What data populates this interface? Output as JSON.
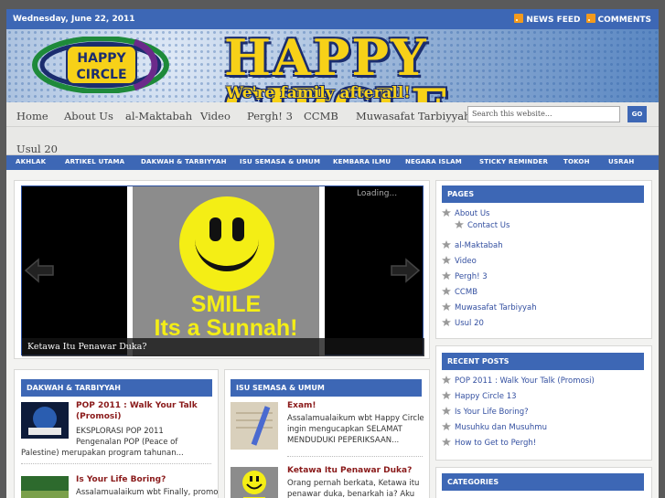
{
  "topbar": {
    "date": "Wednesday, June 22, 2011",
    "news_feed": "NEWS FEED",
    "comments": "COMMENTS"
  },
  "header": {
    "logo_line1": "HAPPY",
    "logo_line2": "CIRCLE",
    "title": "HAPPY CIRCLE",
    "tagline": "We're family afterall!"
  },
  "nav_main": [
    "Home",
    "About Us",
    "al-Maktabah",
    "Video",
    "Pergh! 3",
    "CCMB",
    "Muwasafat Tarbiyyah",
    "Usul 20"
  ],
  "search": {
    "placeholder": "Search this website...",
    "button": "GO"
  },
  "nav_categories": [
    "AKHLAK",
    "ARTIKEL UTAMA",
    "DAKWAH & TARBIYYAH",
    "ISU SEMASA & UMUM",
    "KEMBARA ILMU",
    "NEGARA ISLAM",
    "STICKY REMINDER",
    "TOKOH",
    "USRAH"
  ],
  "slider": {
    "loading": "Loading...",
    "caption": "Ketawa Itu Penawar Duka?",
    "image_text_1": "SMILE",
    "image_text_2": "Its a Sunnah!"
  },
  "dakwah": {
    "heading": "DAKWAH & TARBIYYAH",
    "posts": [
      {
        "title": "POP 2011 : Walk Your Talk (Promosi)",
        "excerpt_1": "EKSPLORASI POP 2011",
        "excerpt_2": "Pengenalan POP (Peace of",
        "excerpt_3": "Palestine) merupakan program tahunan..."
      },
      {
        "title": "Is Your Life Boring?",
        "excerpt_1": "Assalamualaikum wbt Finally, promo"
      }
    ]
  },
  "isu": {
    "heading": "ISU SEMASA & UMUM",
    "posts": [
      {
        "title": "Exam!",
        "excerpt_1": "Assalamualaikum wbt Happy Circle",
        "excerpt_2": "ingin mengucapkan SELAMAT",
        "excerpt_3": "MENDUDUKI PEPERIKSAAN..."
      },
      {
        "title": "Ketawa Itu Penawar Duka?",
        "excerpt_1": "Orang pernah berkata, Ketawa itu",
        "excerpt_2": "penawar duka, benarkah ia? Aku"
      }
    ]
  },
  "pages": {
    "heading": "PAGES",
    "items": [
      "About Us",
      "Contact Us",
      "al-Maktabah",
      "Video",
      "Pergh! 3",
      "CCMB",
      "Muwasafat Tarbiyyah",
      "Usul 20"
    ]
  },
  "recent": {
    "heading": "RECENT POSTS",
    "items": [
      "POP 2011 : Walk Your Talk (Promosi)",
      "Happy Circle 13",
      "Is Your Life Boring?",
      "Musuhku dan Musuhmu",
      "How to Get to Pergh!"
    ]
  },
  "categories": {
    "heading": "CATEGORIES"
  },
  "colors": {
    "accent": "#3d67b5",
    "title_yellow": "#f7d118",
    "post_title": "#8a1a1a",
    "link": "#334fa0"
  }
}
